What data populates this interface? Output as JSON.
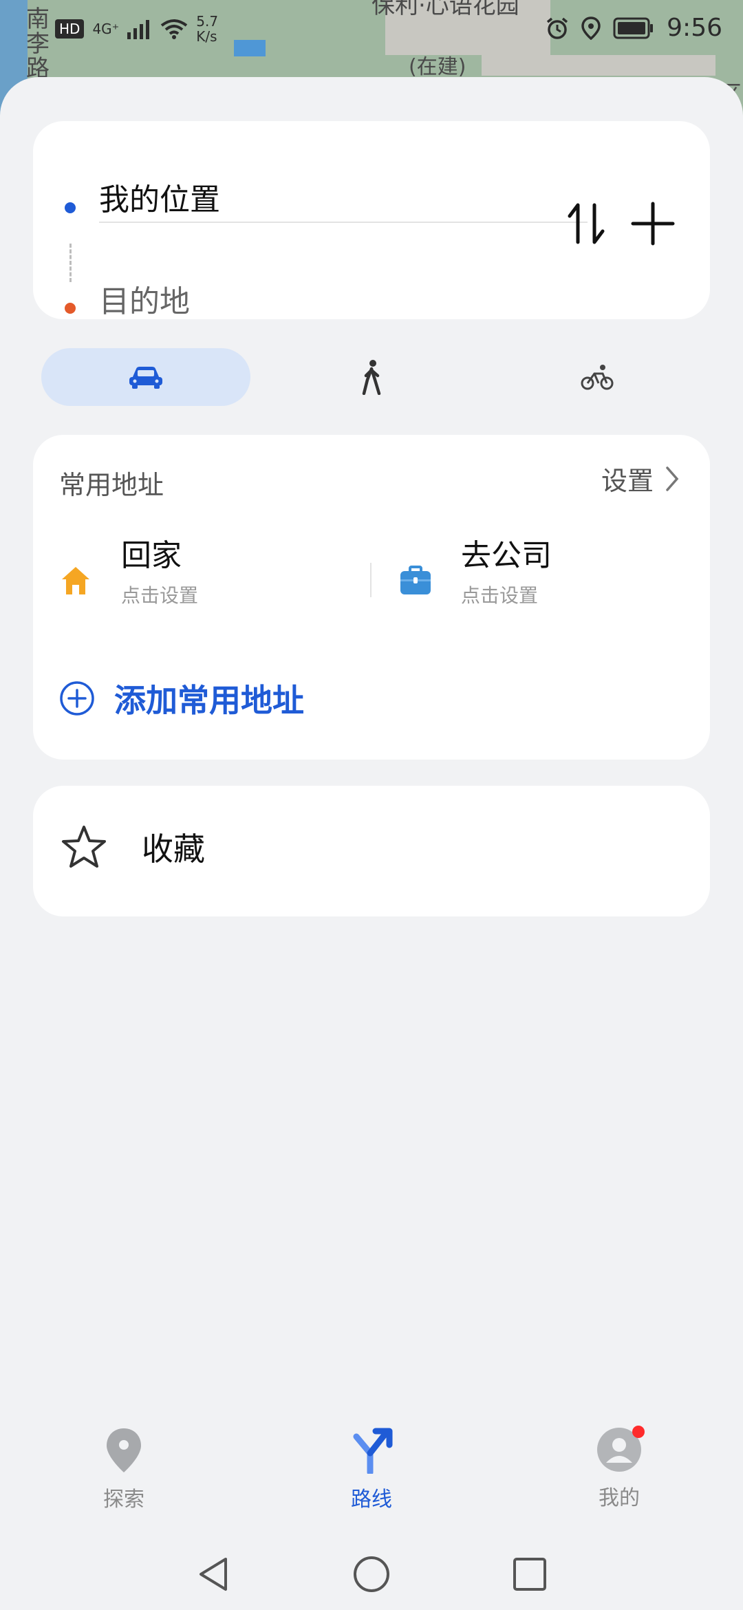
{
  "map": {
    "label_left": "南李路",
    "label_top": "保利·心语花园",
    "label_construction": "(在建)",
    "label_right": "区"
  },
  "status_bar": {
    "hd_badge": "HD",
    "network": "4G⁺",
    "net_speed_value": "5.7",
    "net_speed_unit": "K/s",
    "time": "9:56"
  },
  "route_inputs": {
    "origin": "我的位置",
    "destination": "目的地"
  },
  "mode_tabs": [
    {
      "icon": "car-icon",
      "active": true
    },
    {
      "icon": "walk-icon",
      "active": false
    },
    {
      "icon": "bike-icon",
      "active": false
    }
  ],
  "common_addresses": {
    "title": "常用地址",
    "settings_label": "设置",
    "home": {
      "name": "回家",
      "hint": "点击设置"
    },
    "work": {
      "name": "去公司",
      "hint": "点击设置"
    },
    "add_label": "添加常用地址"
  },
  "favorites": {
    "label": "收藏"
  },
  "bottom_nav": {
    "explore": "探索",
    "route": "路线",
    "mine": "我的"
  },
  "colors": {
    "accent": "#1f5bd6",
    "origin_dot": "#1f5bd6",
    "destination_dot": "#e45a2a",
    "active_tab_bg": "#d9e5f8",
    "home_icon": "#f5a623",
    "work_icon": "#3a8fd8",
    "notification": "#ff2b2b"
  }
}
